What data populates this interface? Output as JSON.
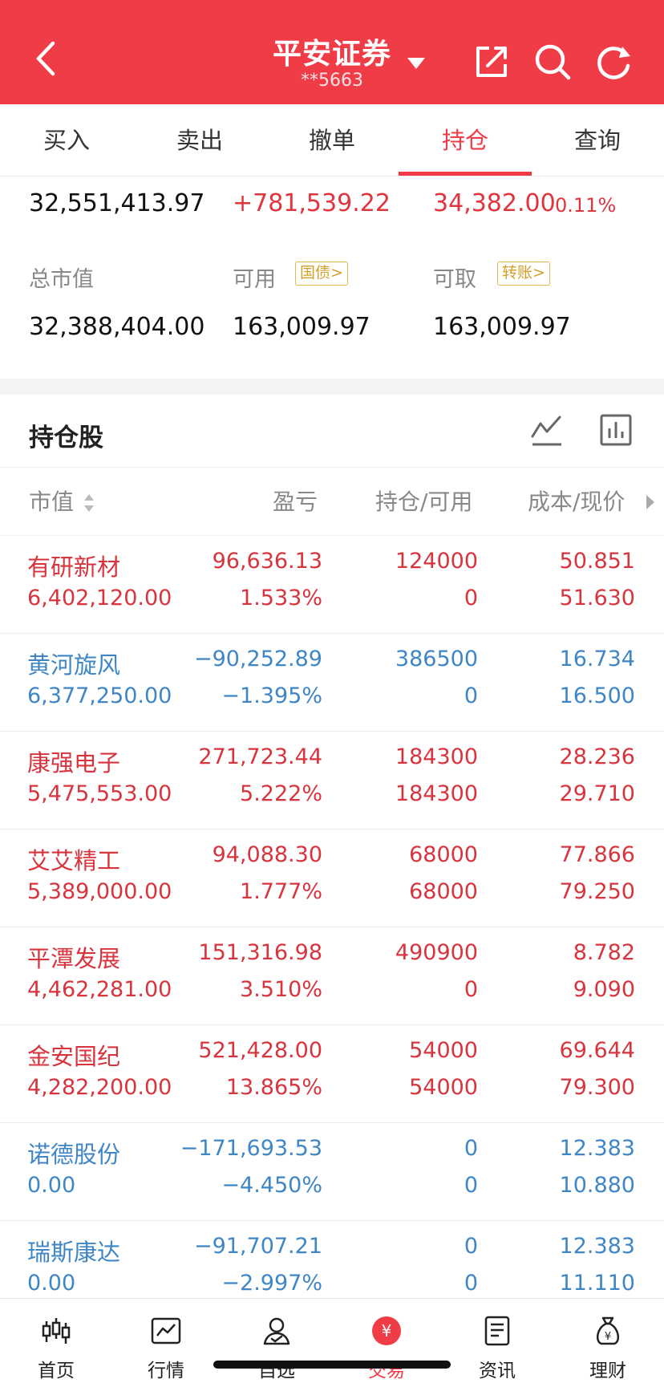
{
  "header": {
    "title": "平安证券",
    "account": "**5663",
    "accent": "#ef3c46"
  },
  "tabs": [
    {
      "label": "买入"
    },
    {
      "label": "卖出"
    },
    {
      "label": "撤单"
    },
    {
      "label": "持仓",
      "active": true
    },
    {
      "label": "查询"
    }
  ],
  "summary": {
    "total_assets": "32,551,413.97",
    "float_pnl": "+781,539.22",
    "today_pnl": "34,382.00",
    "today_pct": "0.11%",
    "market_value_label": "总市值",
    "market_value": "32,388,404.00",
    "available_label": "可用",
    "available_badge": "国债>",
    "available": "163,009.97",
    "withdrawable_label": "可取",
    "withdrawable_badge": "转账>",
    "withdrawable": "163,009.97"
  },
  "holdings": {
    "title": "持仓股",
    "columns": {
      "market_value": "市值",
      "pnl": "盈亏",
      "position": "持仓/可用",
      "cost": "成本/现价"
    },
    "rows": [
      {
        "name": "有研新材",
        "mv": "6,402,120.00",
        "pnl": "96,636.13",
        "pct": "1.533%",
        "hold": "124000",
        "avail": "0",
        "cost": "50.851",
        "price": "51.630",
        "dir": "up"
      },
      {
        "name": "黄河旋风",
        "mv": "6,377,250.00",
        "pnl": "−90,252.89",
        "pct": "−1.395%",
        "hold": "386500",
        "avail": "0",
        "cost": "16.734",
        "price": "16.500",
        "dir": "down"
      },
      {
        "name": "康强电子",
        "mv": "5,475,553.00",
        "pnl": "271,723.44",
        "pct": "5.222%",
        "hold": "184300",
        "avail": "184300",
        "cost": "28.236",
        "price": "29.710",
        "dir": "up"
      },
      {
        "name": "艾艾精工",
        "mv": "5,389,000.00",
        "pnl": "94,088.30",
        "pct": "1.777%",
        "hold": "68000",
        "avail": "68000",
        "cost": "77.866",
        "price": "79.250",
        "dir": "up"
      },
      {
        "name": "平潭发展",
        "mv": "4,462,281.00",
        "pnl": "151,316.98",
        "pct": "3.510%",
        "hold": "490900",
        "avail": "0",
        "cost": "8.782",
        "price": "9.090",
        "dir": "up"
      },
      {
        "name": "金安国纪",
        "mv": "4,282,200.00",
        "pnl": "521,428.00",
        "pct": "13.865%",
        "hold": "54000",
        "avail": "54000",
        "cost": "69.644",
        "price": "79.300",
        "dir": "up"
      },
      {
        "name": "诺德股份",
        "mv": "0.00",
        "pnl": "−171,693.53",
        "pct": "−4.450%",
        "hold": "0",
        "avail": "0",
        "cost": "12.383",
        "price": "10.880",
        "dir": "down"
      },
      {
        "name": "瑞斯康达",
        "mv": "0.00",
        "pnl": "−91,707.21",
        "pct": "−2.997%",
        "hold": "0",
        "avail": "0",
        "cost": "12.383",
        "price": "11.110",
        "dir": "down"
      }
    ]
  },
  "tabbar": [
    {
      "label": "首页",
      "icon": "candlestick-icon"
    },
    {
      "label": "行情",
      "icon": "chart-icon"
    },
    {
      "label": "自选",
      "icon": "user-check-icon"
    },
    {
      "label": "交易",
      "icon": "yuan-icon",
      "active": true
    },
    {
      "label": "资讯",
      "icon": "document-icon"
    },
    {
      "label": "理财",
      "icon": "money-bag-icon"
    }
  ],
  "colors": {
    "up": "#d8343d",
    "down": "#3f86c4",
    "badge": "#d4a02a"
  }
}
